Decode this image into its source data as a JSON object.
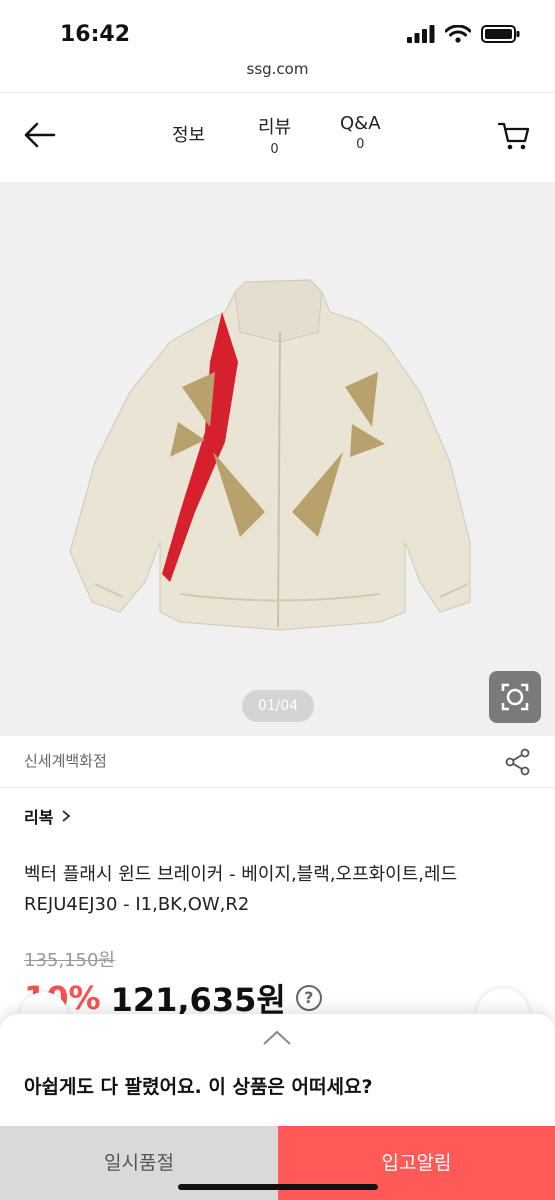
{
  "status": {
    "time": "16:42"
  },
  "browser": {
    "url": "ssg.com"
  },
  "header": {
    "tabs": [
      {
        "label": "정보",
        "count": ""
      },
      {
        "label": "리뷰",
        "count": "0"
      },
      {
        "label": "Q&A",
        "count": "0"
      }
    ]
  },
  "gallery": {
    "indicator": "01/04"
  },
  "store": {
    "name": "신세계백화점"
  },
  "product": {
    "brand": "리복",
    "title": "벡터 플래시 윈드 브레이커 - 베이지,블랙,오프화이트,레드 REJU4EJ30 - I1,BK,OW,R2",
    "original_price": "135,150원",
    "discount": "10%",
    "sale_price": "121,635원"
  },
  "sheet": {
    "message": "아쉽게도 다 팔렸어요. 이 상품은 어떠세요?",
    "soldout_label": "일시품절",
    "notify_label": "입고알림"
  },
  "colors": {
    "accent": "#ff5a57",
    "discount": "#ff4e4e"
  }
}
